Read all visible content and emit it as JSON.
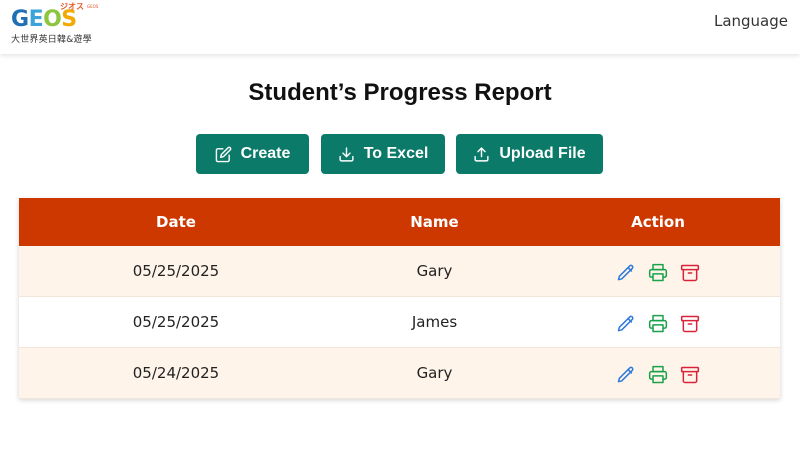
{
  "header": {
    "logo": {
      "superscript": "ジオス",
      "superscript_small": "GEOS",
      "wordmark": [
        "G",
        "E",
        "O",
        "S"
      ],
      "subtitle": "大世界英日韓&遊學"
    },
    "language_label": "Language"
  },
  "page": {
    "title": "Student’s Progress Report"
  },
  "toolbar": {
    "create_label": "Create",
    "excel_label": "To Excel",
    "upload_label": "Upload File"
  },
  "table": {
    "columns": [
      "Date",
      "Name",
      "Action"
    ],
    "rows": [
      {
        "date": "05/25/2025",
        "name": "Gary"
      },
      {
        "date": "05/25/2025",
        "name": "James"
      },
      {
        "date": "05/24/2025",
        "name": "Gary"
      }
    ],
    "action_icons": [
      "pencil-icon",
      "printer-icon",
      "archive-icon"
    ]
  },
  "colors": {
    "primary_button": "#0b7a68",
    "table_header": "#cc3800",
    "row_alt": "#fef4ea",
    "edit_icon": "#2f7bd8",
    "print_icon": "#1aa14a",
    "archive_icon": "#d9233b"
  }
}
